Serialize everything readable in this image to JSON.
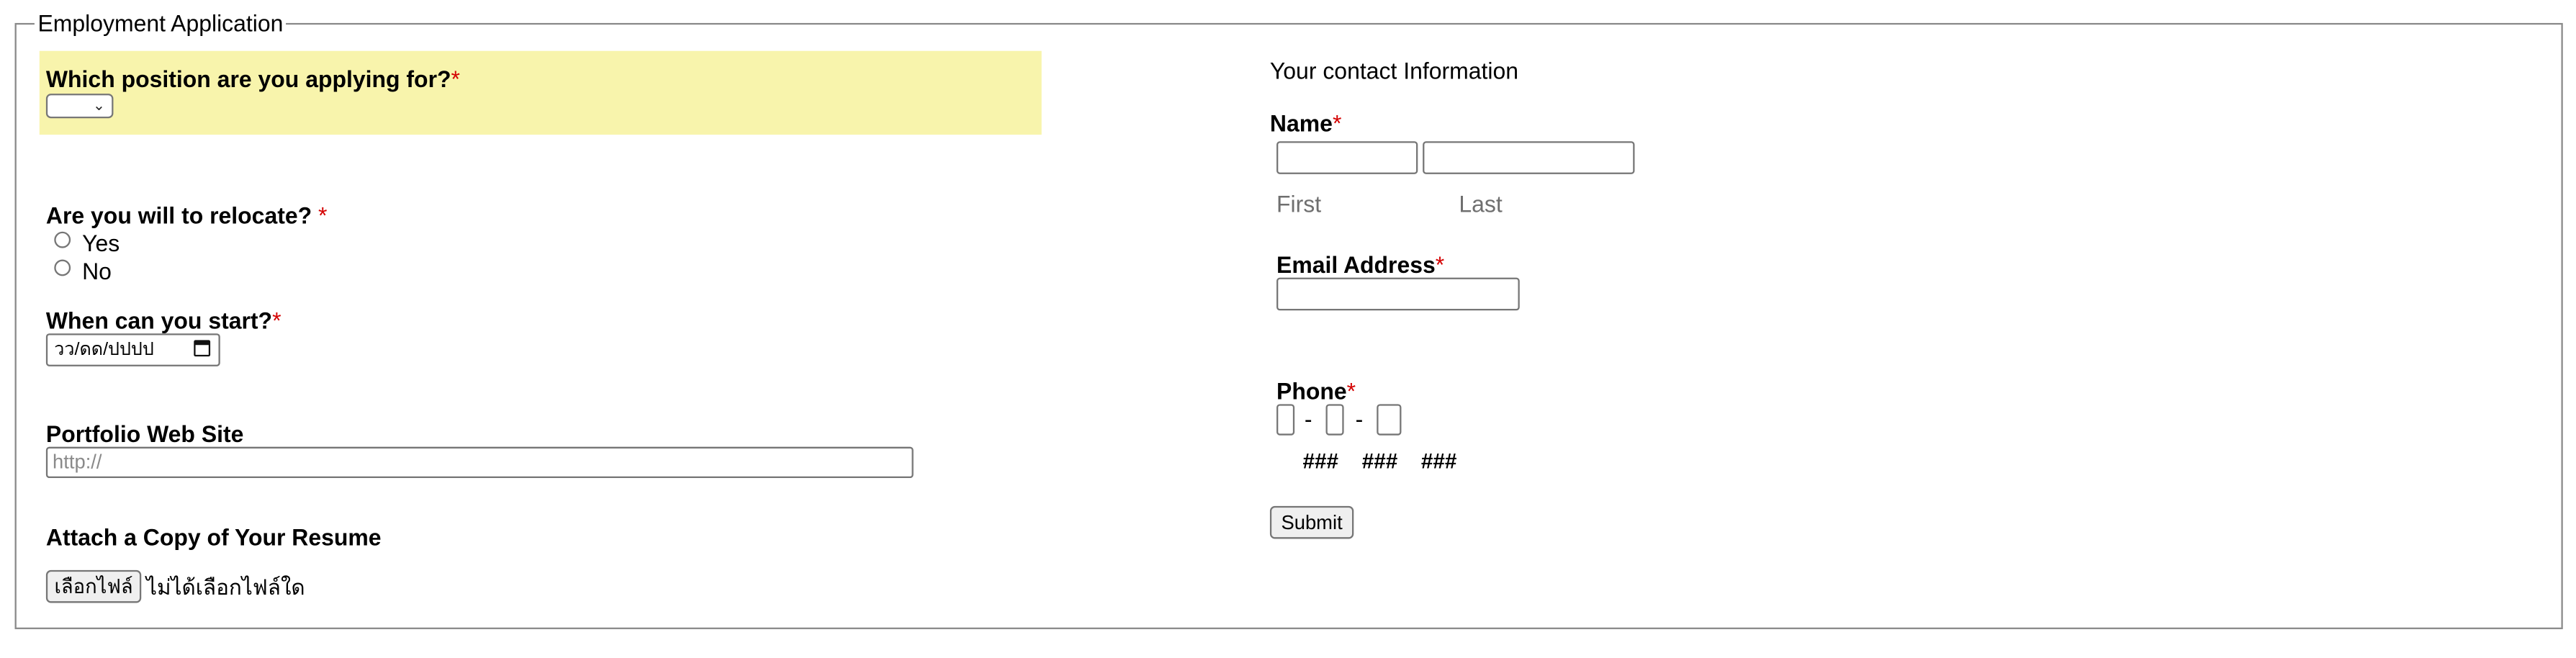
{
  "form": {
    "legend": "Employment Application",
    "position": {
      "label": "Which position are you applying for?",
      "required": "*",
      "selected": ""
    },
    "relocate": {
      "label": "Are you will to relocate?",
      "required": "*",
      "options": [
        "Yes",
        "No"
      ]
    },
    "start": {
      "label": "When can you start?",
      "required": "*",
      "placeholder": "วว/ดด/ปปปป"
    },
    "portfolio": {
      "label": "Portfolio Web Site",
      "placeholder": "http://"
    },
    "resume": {
      "label": "Attach a Copy of Your Resume",
      "button": "เลือกไฟล์",
      "status": "ไม่ได้เลือกไฟล์ใด"
    }
  },
  "contact": {
    "heading": "Your contact Information",
    "name": {
      "label": "Name",
      "required": "*",
      "first": "First",
      "last": "Last"
    },
    "email": {
      "label": "Email Address",
      "required": "*"
    },
    "phone": {
      "label": "Phone",
      "required": "*",
      "separator": "-",
      "hints": [
        "###",
        "###",
        "###"
      ]
    },
    "submit": "Submit"
  }
}
